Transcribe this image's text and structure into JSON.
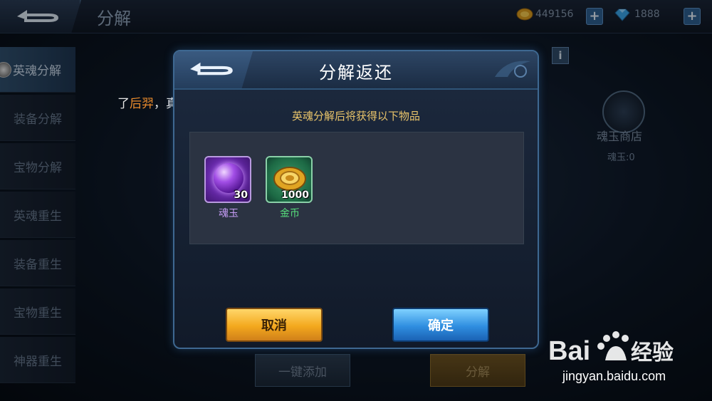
{
  "header": {
    "title": "分解",
    "gold_amount": "449156",
    "gem_amount": "1888",
    "add_label": "+"
  },
  "sidebar": {
    "items": [
      {
        "label": "英魂分解"
      },
      {
        "label": "装备分解"
      },
      {
        "label": "宝物分解"
      },
      {
        "label": "英魂重生"
      },
      {
        "label": "装备重生"
      },
      {
        "label": "宝物重生"
      },
      {
        "label": "神器重生"
      }
    ]
  },
  "background": {
    "msg_prefix": "了",
    "msg_highlight": "后羿",
    "msg_suffix": "，真是羡煞旁人！",
    "info_label": "i",
    "shop_label": "魂玉商店",
    "shop_count": "魂玉:0",
    "auto_add_label": "一键添加",
    "decompose_label": "分解"
  },
  "dialog": {
    "title": "分解返还",
    "subtitle": "英魂分解后将获得以下物品",
    "items": [
      {
        "name": "魂玉",
        "count": "30",
        "icon": "soul-jade-icon"
      },
      {
        "name": "金币",
        "count": "1000",
        "icon": "gold-coin-icon"
      }
    ],
    "cancel_label": "取消",
    "confirm_label": "确定"
  },
  "watermark": {
    "logo_text": "Bai经验",
    "url": "jingyan.baidu.com"
  },
  "colors": {
    "accent_blue": "#3e6891",
    "gold_text": "#e9c46a",
    "highlight_orange": "#ea8b2c",
    "soul_purple": "#c59cf5",
    "gold_green": "#57e07c"
  }
}
